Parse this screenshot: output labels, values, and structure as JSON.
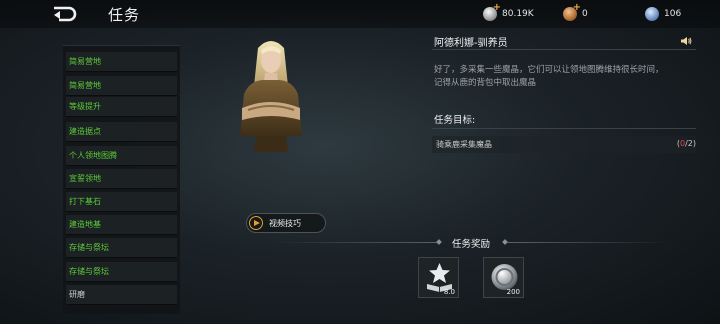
{
  "header": {
    "title": "任务",
    "resources": [
      {
        "icon": "silver-coin-icon",
        "value": "80.19K"
      },
      {
        "icon": "bronze-coin-icon",
        "value": "0"
      },
      {
        "icon": "blue-gem-icon",
        "value": "106"
      }
    ]
  },
  "sidebar": {
    "items": [
      {
        "label": "简易营地",
        "state": "active"
      },
      {
        "label": "简易营地",
        "state": "active"
      },
      {
        "label": "等级提升",
        "state": "active"
      },
      {
        "label": "建造据点",
        "state": "active"
      },
      {
        "label": "个人领地图腾",
        "state": "active"
      },
      {
        "label": "宣誓领地",
        "state": "active"
      },
      {
        "label": "打下基石",
        "state": "active"
      },
      {
        "label": "建造地基",
        "state": "active"
      },
      {
        "label": "存储与祭坛",
        "state": "active"
      },
      {
        "label": "存储与祭坛",
        "state": "active"
      },
      {
        "label": "研磨",
        "state": "muted"
      }
    ]
  },
  "video_button": {
    "label": "视频技巧"
  },
  "npc": {
    "name": "阿德利娜-驯养员",
    "dialog": [
      "好了，多采集一些魔晶，它们可以让领地图腾维持很长时间，",
      "记得从鹿的背包中取出魔晶"
    ]
  },
  "objectives": {
    "heading": "任务目标:",
    "items": [
      {
        "text": "骑乘鹿采集魔晶",
        "current": "0",
        "total": "/2"
      }
    ]
  },
  "rewards": {
    "heading": "任务奖励",
    "items": [
      {
        "icon": "experience-book-icon",
        "qty": "8.0"
      },
      {
        "icon": "silver-coin-icon",
        "qty": "200"
      }
    ]
  },
  "colors": {
    "active_text": "#5dcc3a",
    "progress_current": "#e04848",
    "accent": "#e0a030"
  }
}
